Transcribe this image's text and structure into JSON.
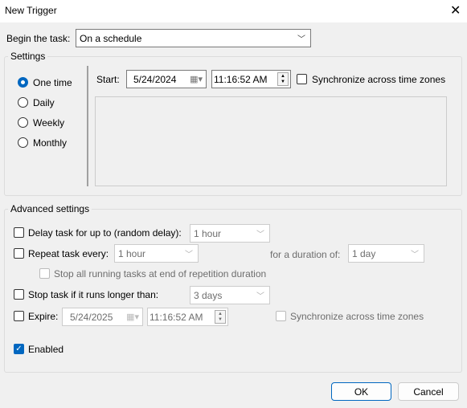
{
  "window": {
    "title": "New Trigger",
    "close_icon": "close-icon"
  },
  "begin": {
    "label": "Begin the task:",
    "value": "On a schedule"
  },
  "settings": {
    "label": "Settings",
    "options": [
      "One time",
      "Daily",
      "Weekly",
      "Monthly"
    ],
    "selected": "One time",
    "start_label": "Start:",
    "start_date": "5/24/2024",
    "start_time": "11:16:52 AM",
    "sync_label": "Synchronize across time zones",
    "sync_checked": false
  },
  "advanced": {
    "label": "Advanced settings",
    "delay": {
      "label": "Delay task for up to (random delay):",
      "value": "1 hour",
      "checked": false
    },
    "repeat": {
      "label": "Repeat task every:",
      "value": "1 hour",
      "checked": false,
      "duration_label": "for a duration of:",
      "duration_value": "1 day"
    },
    "stop_all": {
      "label": "Stop all running tasks at end of repetition duration",
      "checked": false
    },
    "stop_longer": {
      "label": "Stop task if it runs longer than:",
      "value": "3 days",
      "checked": false
    },
    "expire": {
      "label": "Expire:",
      "date": "5/24/2025",
      "time": "11:16:52 AM",
      "checked": false,
      "sync_label": "Synchronize across time zones"
    },
    "enabled": {
      "label": "Enabled",
      "checked": true
    }
  },
  "buttons": {
    "ok": "OK",
    "cancel": "Cancel"
  },
  "colors": {
    "accent": "#0067c0"
  }
}
